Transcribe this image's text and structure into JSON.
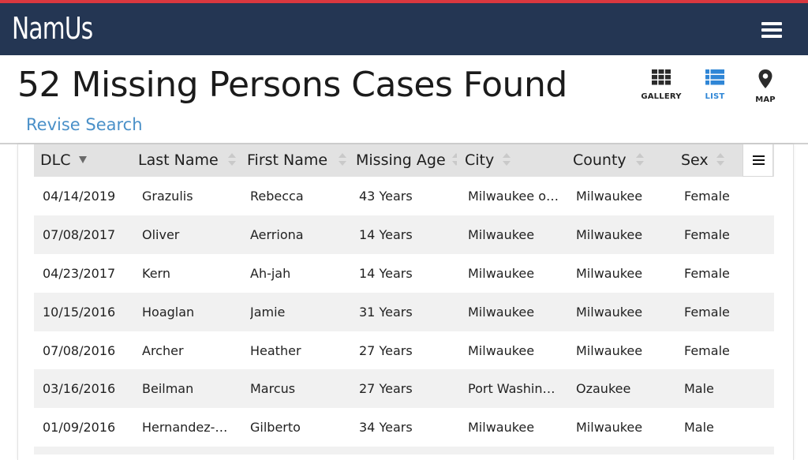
{
  "header": {
    "logo": "NamUs",
    "menu_icon": "hamburger-menu-icon"
  },
  "page": {
    "title": "52 Missing Persons Cases Found",
    "revise_link": "Revise Search"
  },
  "view_toggle": {
    "active": "list",
    "items": [
      {
        "label": "GALLERY",
        "icon": "grid-icon"
      },
      {
        "label": "LIST",
        "icon": "list-icon"
      },
      {
        "label": "MAP",
        "icon": "map-pin-icon"
      }
    ]
  },
  "colors": {
    "navbar": "#243653",
    "accent_stripe": "#d9383f",
    "link": "#4a90c8",
    "active_view": "#2f86d6"
  },
  "table": {
    "columns": [
      "DLC",
      "Last Name",
      "First Name",
      "Missing Age",
      "City",
      "County",
      "Sex"
    ],
    "sorted_column": "DLC",
    "sort_direction": "descending",
    "column_menu_icon": "column-menu-icon",
    "rows": [
      [
        "04/14/2019",
        "Grazulis",
        "Rebecca",
        "43 Years",
        "Milwaukee o…",
        "Milwaukee",
        "Female"
      ],
      [
        "07/08/2017",
        "Oliver",
        "Aerriona",
        "14 Years",
        "Milwaukee",
        "Milwaukee",
        "Female"
      ],
      [
        "04/23/2017",
        "Kern",
        "Ah-jah",
        "14 Years",
        "Milwaukee",
        "Milwaukee",
        "Female"
      ],
      [
        "10/15/2016",
        "Hoaglan",
        "Jamie",
        "31 Years",
        "Milwaukee",
        "Milwaukee",
        "Female"
      ],
      [
        "07/08/2016",
        "Archer",
        "Heather",
        "27 Years",
        "Milwaukee",
        "Milwaukee",
        "Female"
      ],
      [
        "03/16/2016",
        "Beilman",
        "Marcus",
        "27 Years",
        "Port Washin…",
        "Ozaukee",
        "Male"
      ],
      [
        "01/09/2016",
        "Hernandez-…",
        "Gilberto",
        "34 Years",
        "Milwaukee",
        "Milwaukee",
        "Male"
      ]
    ]
  }
}
